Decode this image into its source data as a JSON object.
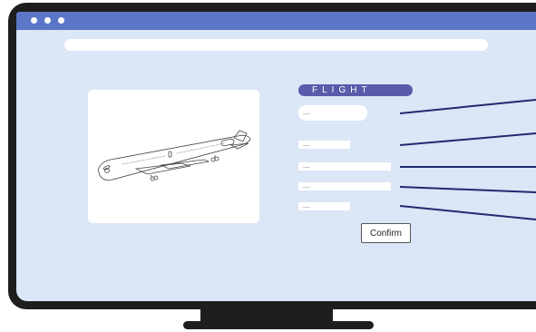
{
  "colors": {
    "bezel": "#1e1e1e",
    "screen": "#dbe6f6",
    "titlebar": "#5b76c6",
    "heading": "#5a5bab",
    "connector": "#1f2b6e"
  },
  "window": {
    "controls": [
      "window-dot",
      "window-dot",
      "window-dot"
    ]
  },
  "form": {
    "title": "FLIGHT",
    "fields": [
      {
        "value": "...."
      },
      {
        "value": "...."
      },
      {
        "value": "...."
      },
      {
        "value": "...."
      },
      {
        "value": "...."
      }
    ],
    "confirm_label": "Confirm"
  },
  "image": {
    "subject": "airplane-illustration"
  }
}
